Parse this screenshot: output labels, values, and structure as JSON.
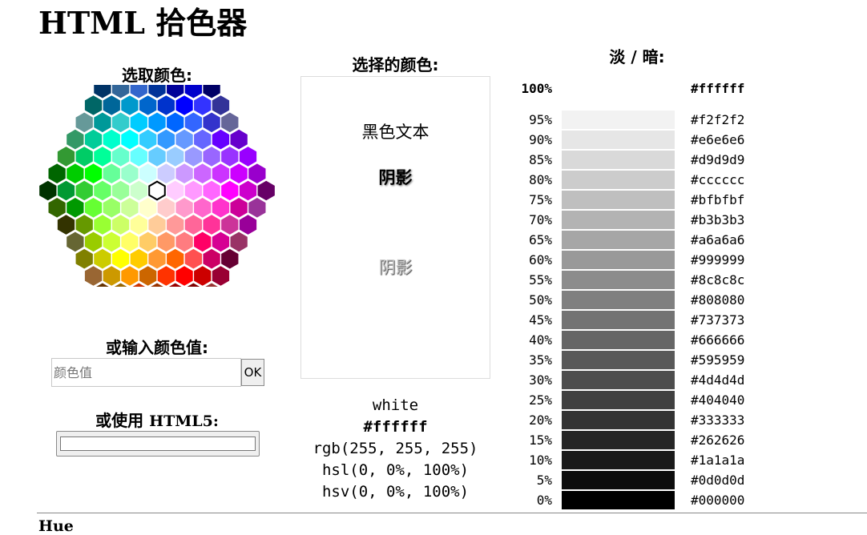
{
  "page": {
    "title": "HTML 拾色器"
  },
  "picker": {
    "heading": "选取颜色:",
    "rows": [
      [
        "#003366",
        "#336699",
        "#3366CC",
        "#003399",
        "#000099",
        "#0000CC",
        "#000066"
      ],
      [
        "#006666",
        "#006699",
        "#0099CC",
        "#0066CC",
        "#0033CC",
        "#0000FF",
        "#3333FF",
        "#333399"
      ],
      [
        "#669999",
        "#009999",
        "#33CCCC",
        "#00CCFF",
        "#0099FF",
        "#0066FF",
        "#3366FF",
        "#3333CC",
        "#666699"
      ],
      [
        "#339966",
        "#00CC99",
        "#00FFCC",
        "#00FFFF",
        "#33CCFF",
        "#3399FF",
        "#6699FF",
        "#6666FF",
        "#6600FF",
        "#6600CC"
      ],
      [
        "#339933",
        "#00CC66",
        "#00FF99",
        "#66FFCC",
        "#66FFFF",
        "#66CCFF",
        "#99CCFF",
        "#9999FF",
        "#9966FF",
        "#9933FF",
        "#9900FF"
      ],
      [
        "#006600",
        "#00CC00",
        "#00FF00",
        "#66FF99",
        "#99FFCC",
        "#CCFFFF",
        "#CCCCFF",
        "#CC99FF",
        "#CC66FF",
        "#CC33FF",
        "#CC00FF",
        "#9900CC"
      ],
      [
        "#003300",
        "#009933",
        "#33CC33",
        "#66FF66",
        "#99FF99",
        "#CCFFCC",
        "#FFFFFF",
        "#FFCCFF",
        "#FF99FF",
        "#FF66FF",
        "#FF00FF",
        "#CC00CC",
        "#660066"
      ],
      [
        "#336600",
        "#009900",
        "#66FF33",
        "#99FF66",
        "#CCFF99",
        "#FFFFCC",
        "#FFCCCC",
        "#FF99CC",
        "#FF66CC",
        "#FF33CC",
        "#CC0099",
        "#993399"
      ],
      [
        "#333300",
        "#669900",
        "#99FF33",
        "#CCFF66",
        "#FFFF99",
        "#FFCC99",
        "#FF9999",
        "#FF6699",
        "#FF3399",
        "#CC3399",
        "#990099"
      ],
      [
        "#666633",
        "#99CC00",
        "#CCFF33",
        "#FFFF66",
        "#FFCC66",
        "#FF9966",
        "#FF7C80",
        "#FF0066",
        "#D60093",
        "#993366"
      ],
      [
        "#808000",
        "#CCCC00",
        "#FFFF00",
        "#FFCC00",
        "#FF9933",
        "#FF6600",
        "#FF5050",
        "#CC0066",
        "#660033"
      ],
      [
        "#996633",
        "#CC9900",
        "#FF9900",
        "#CC6600",
        "#FF3300",
        "#FF0000",
        "#CC0000",
        "#990033"
      ],
      [
        "#663300",
        "#996600",
        "#CC3300",
        "#993300",
        "#990000",
        "#800000",
        "#993333"
      ]
    ],
    "selected_color": "#FFFFFF"
  },
  "preview": {
    "heading": "选择的颜色:",
    "black_text": "黑色文本",
    "shadow_text_1": "阴影",
    "shadow_text_2": "阴影"
  },
  "color_input": {
    "heading": "或输入颜色值:",
    "placeholder": "颜色值",
    "value": "",
    "ok_label": "OK"
  },
  "html5": {
    "heading_prefix": "或使用 ",
    "heading_suffix": "HTML5:",
    "value": "#ffffff"
  },
  "color_info": {
    "name": "white",
    "hex": "#ffffff",
    "rgb": "rgb(255, 255, 255)",
    "hsl": "hsl(0, 0%, 100%)",
    "hsv": "hsv(0, 0%, 100%)"
  },
  "lighter_darker": {
    "heading": "淡 / 暗:",
    "rows": [
      {
        "pct": "100%",
        "hex": "#ffffff"
      },
      {
        "pct": "95%",
        "hex": "#f2f2f2"
      },
      {
        "pct": "90%",
        "hex": "#e6e6e6"
      },
      {
        "pct": "85%",
        "hex": "#d9d9d9"
      },
      {
        "pct": "80%",
        "hex": "#cccccc"
      },
      {
        "pct": "75%",
        "hex": "#bfbfbf"
      },
      {
        "pct": "70%",
        "hex": "#b3b3b3"
      },
      {
        "pct": "65%",
        "hex": "#a6a6a6"
      },
      {
        "pct": "60%",
        "hex": "#999999"
      },
      {
        "pct": "55%",
        "hex": "#8c8c8c"
      },
      {
        "pct": "50%",
        "hex": "#808080"
      },
      {
        "pct": "45%",
        "hex": "#737373"
      },
      {
        "pct": "40%",
        "hex": "#666666"
      },
      {
        "pct": "35%",
        "hex": "#595959"
      },
      {
        "pct": "30%",
        "hex": "#4d4d4d"
      },
      {
        "pct": "25%",
        "hex": "#404040"
      },
      {
        "pct": "20%",
        "hex": "#333333"
      },
      {
        "pct": "15%",
        "hex": "#262626"
      },
      {
        "pct": "10%",
        "hex": "#1a1a1a"
      },
      {
        "pct": "5%",
        "hex": "#0d0d0d"
      },
      {
        "pct": "0%",
        "hex": "#000000"
      }
    ]
  },
  "hue_section": {
    "heading": "Hue"
  }
}
